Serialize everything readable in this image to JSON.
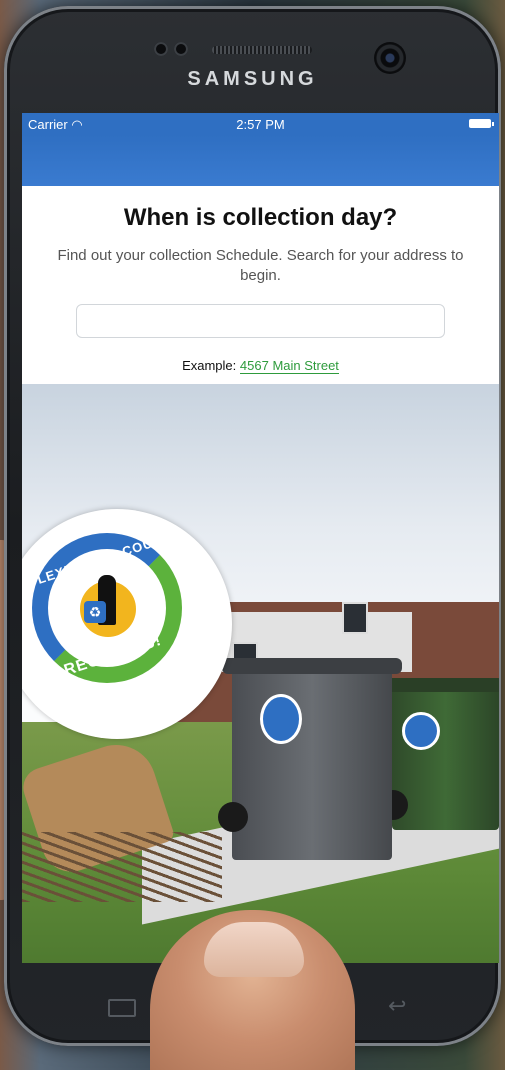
{
  "device": {
    "brand": "SAMSUNG"
  },
  "status_bar": {
    "carrier": "Carrier",
    "wifi_icon": "wifi-icon",
    "time": "2:57 PM",
    "battery_icon": "battery-icon"
  },
  "page": {
    "title": "When is collection day?",
    "description": "Find out your collection Schedule. Search for your address to begin.",
    "search": {
      "value": "",
      "placeholder": ""
    },
    "example_label": "Example:",
    "example_link": "4567 Main Street"
  },
  "logo": {
    "top_text": "LEXINGTON COUNTY",
    "bottom_text": "RECYCLES!"
  },
  "colors": {
    "navbar": "#2f6fc2",
    "link": "#2e9b3c",
    "logo_blue": "#2e6fc2",
    "logo_green": "#5cb23c"
  }
}
